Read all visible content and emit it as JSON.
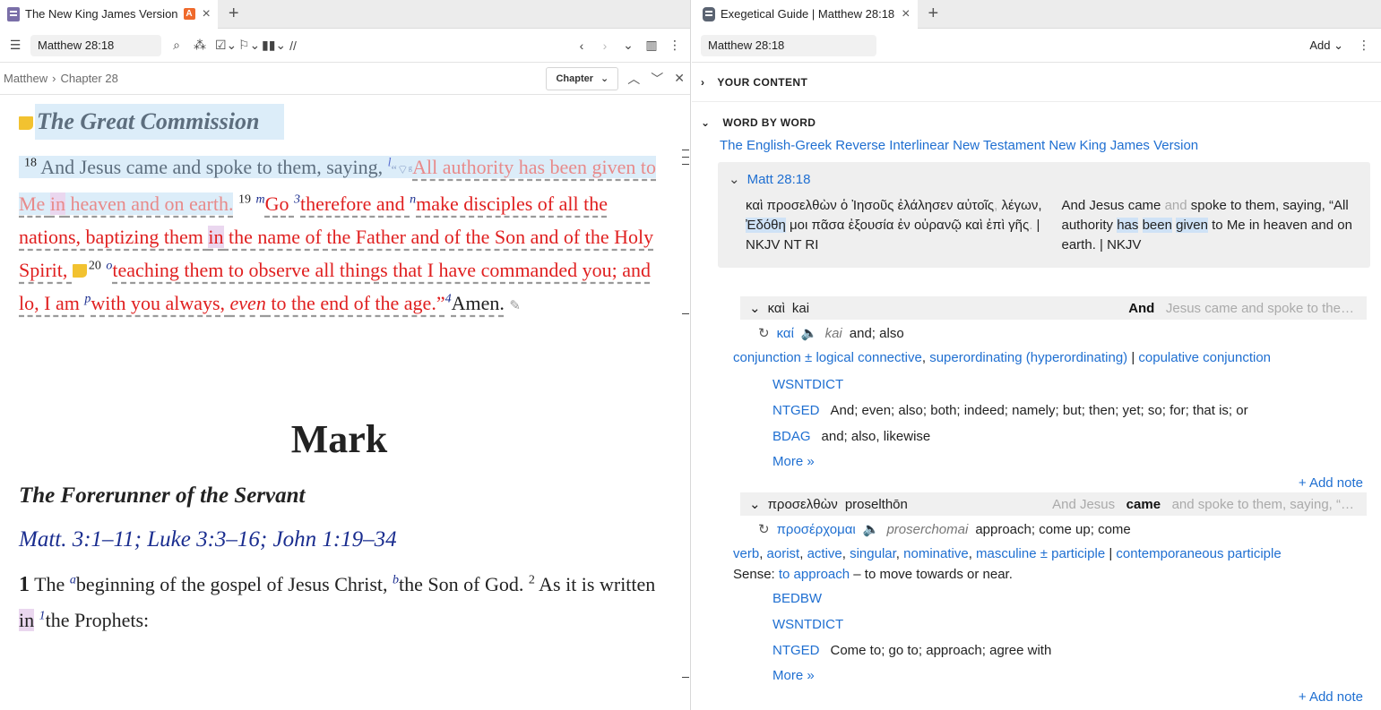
{
  "left": {
    "tab": {
      "title": "The New King James Version",
      "badge": "A",
      "close": "×",
      "add": "+"
    },
    "toolbar": {
      "reference": "Matthew 28:18"
    },
    "breadcrumb": {
      "book": "Matthew",
      "sep": "›",
      "chapter": "Chapter 28",
      "chapter_button": "Chapter"
    },
    "passage": {
      "heading": "The Great Commission",
      "v18_num": "18",
      "v18_text": "And Jesus came and spoke to them, saying, ",
      "v18_fn": "l",
      "v18_quote_a": "All authority has been given to Me ",
      "v18_in": "in",
      "v18_quote_b": " heaven and on earth.",
      "v19_num": "19",
      "v19_fn1": "m",
      "v19_a": "Go ",
      "v19_fn2": "3",
      "v19_b": "therefore and ",
      "v19_fn3": "n",
      "v19_c": "make disciples of all the nations, baptizing them ",
      "v19_in": "in",
      "v19_d": " the name of the Father and of the Son and of the Holy Spirit, ",
      "v20_num": "20",
      "v20_fn1": "o",
      "v20_a": "teaching them to observe all things that I have commanded you; and lo, I am ",
      "v20_fn2": "p",
      "v20_b": "with you always, ",
      "v20_even": "even",
      "v20_c": " to the end of the age.”",
      "v20_fn3": "4",
      "v20_amen": "Amen."
    },
    "mark": {
      "book_title": "Mark",
      "section": "The Forerunner of the Servant",
      "xref": "Matt. 3:1–11; Luke 3:3–16; John 1:19–34",
      "ch_num": "1",
      "v1_a": "The ",
      "v1_fn1": "a",
      "v1_b": "beginning of the gospel of Jesus Christ, ",
      "v1_fn2": "b",
      "v1_c": "the Son of God. ",
      "v2_num": "2",
      "v2_a": " As it is written ",
      "v2_in": "in",
      "v2_fn": "1",
      "v2_b": "the Prophets:"
    }
  },
  "right": {
    "tab": {
      "title": "Exegetical Guide | Matthew 28:18",
      "close": "×",
      "add": "+"
    },
    "toolbar": {
      "reference": "Matthew 28:18",
      "add_label": "Add"
    },
    "your_content": "YOUR CONTENT",
    "word_by_word": "WORD BY WORD",
    "resource": "The English-Greek Reverse Interlinear New Testament New King James Version",
    "verse": {
      "ref": "Matt 28:18",
      "greek_a": "καὶ προσελθὼν ὁ Ἰησοῦς ἐλάλησεν αὐτοῖς",
      "greek_comma": ",",
      "greek_b": " λέγων,",
      "greek_c": " Ἐδόθη",
      "greek_d": " μοι πᾶσα ἐξουσία ἐν οὐρανῷ καὶ ἐπὶ γῆς",
      "greek_dot": ".",
      "greek_src": "  | NKJV NT RI",
      "eng_a": "And Jesus came ",
      "eng_and": "and",
      "eng_b": " spoke to them, saying, “All authority ",
      "eng_has": "has",
      "eng_been": "been",
      "eng_given": "given",
      "eng_c": " to Me in heaven and on earth.",
      "eng_src": "  | NKJV"
    },
    "words": [
      {
        "greek": "καὶ",
        "translit": "kai",
        "right_bold": "And",
        "right_after": "Jesus came and spoke to the…",
        "lemma": "καί",
        "lemma_translit": "kai",
        "gloss": "and; also",
        "morph": [
          "conjunction ± logical connective",
          "superordinating (hyperordinating)",
          "copulative conjunction"
        ],
        "dicts": [
          {
            "name": "WSNTDICT",
            "def": ""
          },
          {
            "name": "NTGED",
            "def": "And; even; also; both; indeed; namely; but; then; yet; so; for; that is; or"
          },
          {
            "name": "BDAG",
            "def": "and; also, likewise"
          }
        ],
        "more": "More »",
        "add_note": "+ Add note"
      },
      {
        "greek": "προσελθὼν",
        "translit": "proselthōn",
        "right_before": "And Jesus",
        "right_bold": "came",
        "right_after": "and spoke to them, saying, “…",
        "lemma": "προσέρχομαι",
        "lemma_translit": "proserchomai",
        "gloss": "approach; come up; come",
        "morph": [
          "verb",
          "aorist",
          "active",
          "singular",
          "nominative",
          "masculine ± participle",
          "contemporaneous participle"
        ],
        "sense_label": "Sense:",
        "sense_link": "to approach",
        "sense_def": " – to move towards or near.",
        "dicts": [
          {
            "name": "BEDBW",
            "def": ""
          },
          {
            "name": "WSNTDICT",
            "def": ""
          },
          {
            "name": "NTGED",
            "def": "Come to; go to; approach; agree with"
          }
        ],
        "more": "More »",
        "add_note": "+ Add note"
      }
    ]
  }
}
